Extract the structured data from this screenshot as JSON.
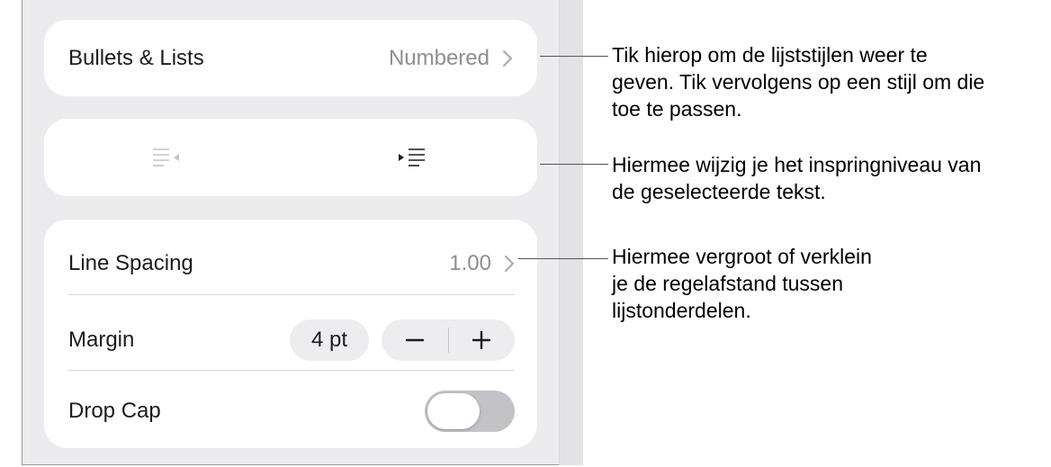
{
  "bullets_lists": {
    "label": "Bullets & Lists",
    "value": "Numbered"
  },
  "indent": {
    "decrease_icon": "decrease-indent-icon",
    "increase_icon": "increase-indent-icon"
  },
  "line_spacing": {
    "label": "Line Spacing",
    "value": "1.00"
  },
  "margin": {
    "label": "Margin",
    "value": "4 pt",
    "minus": "−",
    "plus": "+"
  },
  "drop_cap": {
    "label": "Drop Cap",
    "enabled": false
  },
  "callouts": [
    {
      "line1": "Tik hierop om de lijststijlen weer te",
      "line2": "geven. Tik vervolgens op een stijl om die",
      "line3": "toe te passen."
    },
    {
      "line1": "Hiermee wijzig je het inspringniveau van",
      "line2": "de geselecteerde tekst."
    },
    {
      "line1": "Hiermee vergroot of verklein",
      "line2": "je de regelafstand tussen",
      "line3": "lijstonderdelen."
    }
  ],
  "colors": {
    "panel": "#ececee",
    "card": "#ffffff",
    "secondary_text": "#8e8e93",
    "toggle_off": "#c3c3c7"
  }
}
